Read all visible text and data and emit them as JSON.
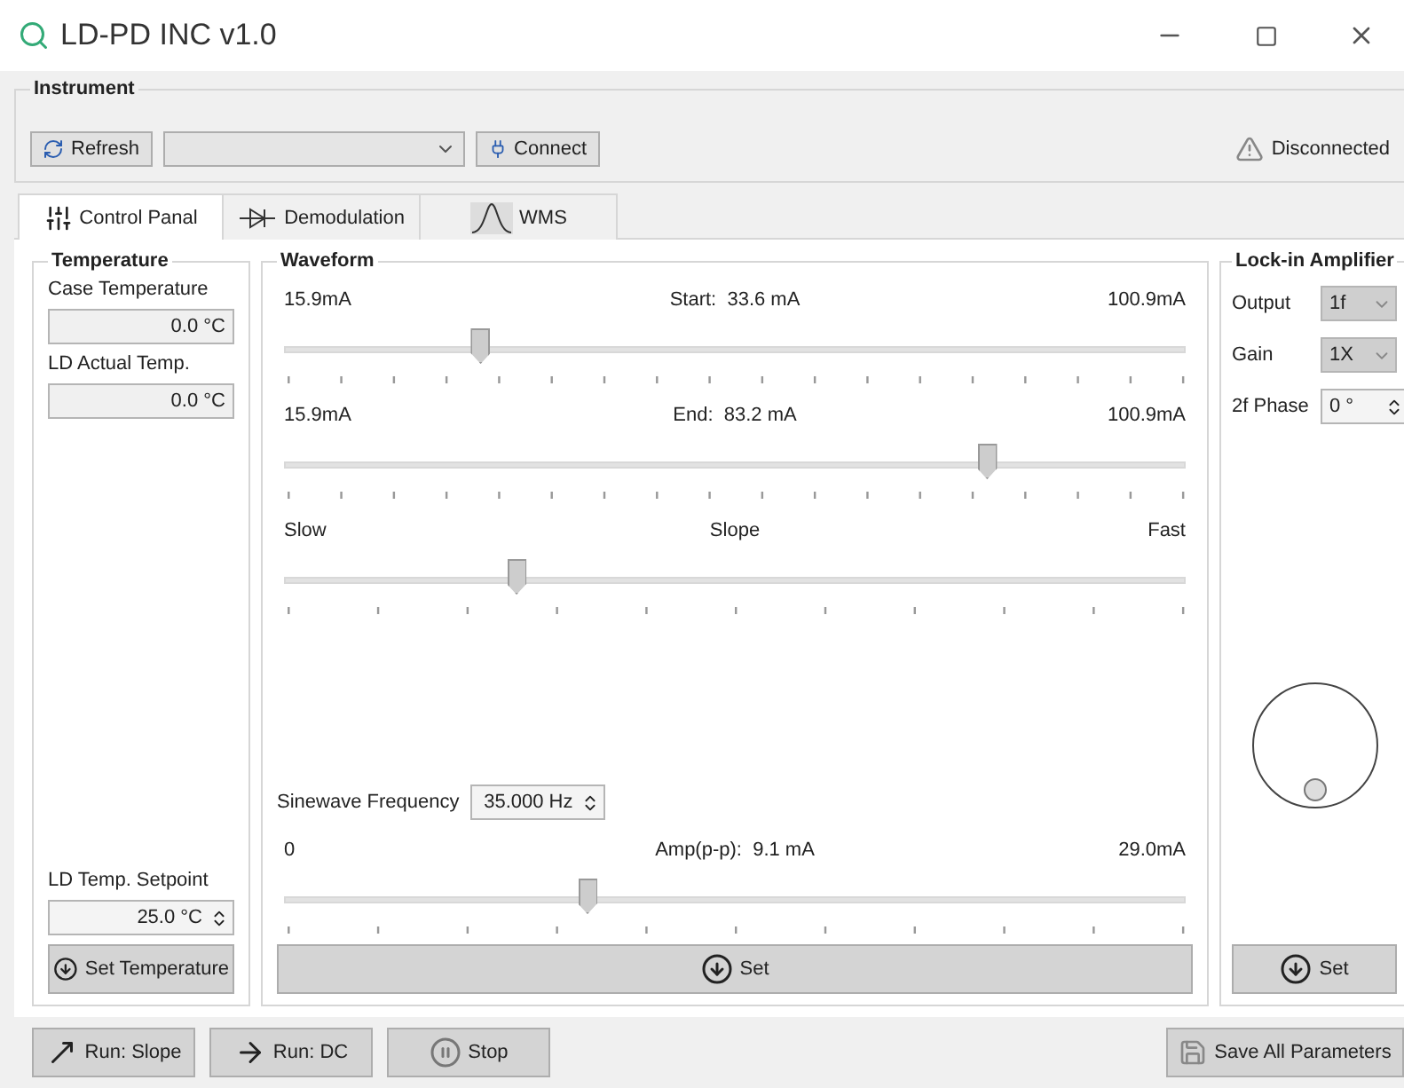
{
  "window": {
    "title": "LD-PD INC v1.0"
  },
  "instrument": {
    "title": "Instrument",
    "refresh_button": "Refresh",
    "connect_button": "Connect",
    "status": "Disconnected"
  },
  "tabs": [
    {
      "label": "Control Panal",
      "kind": "sliders",
      "selected": true
    },
    {
      "label": "Demodulation",
      "kind": "diode",
      "selected": false
    },
    {
      "label": "WMS",
      "kind": "curve",
      "selected": false
    }
  ],
  "temperature": {
    "title": "Temperature",
    "case_label": "Case Temperature",
    "case_value": "0.0 °C",
    "actual_label": "LD Actual Temp.",
    "actual_value": "0.0 °C",
    "setpoint_label": "LD Temp. Setpoint",
    "setpoint_value": "25.0 °C",
    "set_button": "Set Temperature"
  },
  "waveform": {
    "title": "Waveform",
    "sliders": [
      {
        "min_label": "15.9mA",
        "caption": "Start:  33.6 mA",
        "max_label": "100.9mA",
        "level": 0.216
      },
      {
        "min_label": "15.9mA",
        "caption": "End:  83.2 mA",
        "max_label": "100.9mA",
        "level": 0.78
      },
      {
        "min_label": "Slow",
        "caption": "Slope",
        "max_label": "Fast",
        "level": 0.256
      }
    ],
    "frequency_label": "Sinewave Frequency",
    "frequency_value": "35.000 Hz",
    "amplitude": {
      "min_label": "0",
      "caption": "Amp(p-p):  9.1 mA",
      "max_label": "29.0mA",
      "level": 0.335
    },
    "set_button": "Set"
  },
  "lockin": {
    "title": "Lock-in Amplifier",
    "fields": [
      {
        "label": "Output",
        "value": "1f",
        "kind": "select"
      },
      {
        "label": "Gain",
        "value": "1X",
        "kind": "select"
      },
      {
        "label": "2f Phase",
        "value": "0 °",
        "kind": "spin"
      }
    ],
    "set_button": "Set"
  },
  "bottom_buttons": [
    {
      "label": "Run: Slope",
      "kind": "slope"
    },
    {
      "label": "Run: DC",
      "kind": "dc"
    },
    {
      "label": "Stop",
      "kind": "stop"
    }
  ],
  "save_button": "Save All Parameters"
}
